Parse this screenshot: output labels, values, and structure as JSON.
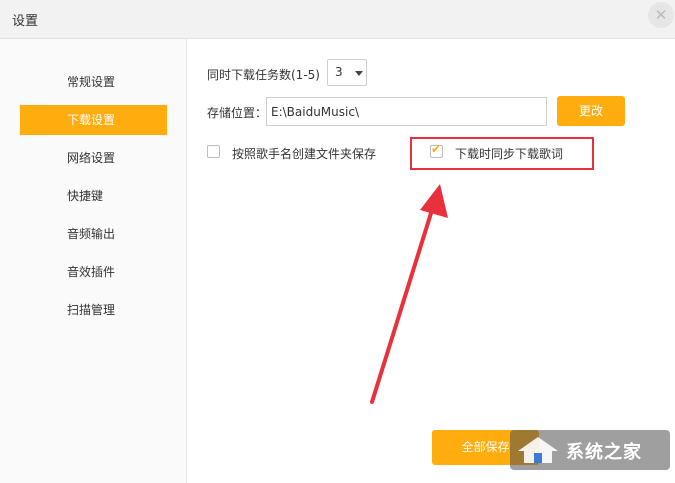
{
  "window": {
    "title": "设置",
    "close_glyph": "✕"
  },
  "sidebar": {
    "items": [
      {
        "label": "常规设置",
        "active": false
      },
      {
        "label": "下载设置",
        "active": true
      },
      {
        "label": "网络设置",
        "active": false
      },
      {
        "label": "快捷键",
        "active": false
      },
      {
        "label": "音频输出",
        "active": false
      },
      {
        "label": "音效插件",
        "active": false
      },
      {
        "label": "扫描管理",
        "active": false
      }
    ]
  },
  "download": {
    "tasks_label": "同时下载任务数(1-5)",
    "tasks_value": "3",
    "path_label": "存储位置：",
    "path_value": "E:\\BaiduMusic\\",
    "change_button": "更改",
    "create_folder_label": "按照歌手名创建文件夹保存",
    "create_folder_checked": false,
    "sync_lyrics_label": "下载时同步下载歌词",
    "sync_lyrics_checked": true
  },
  "footer": {
    "save_all": "全部保存"
  },
  "watermark": {
    "text": "系统之家"
  },
  "colors": {
    "accent": "#ffac0e",
    "annotation": "#e8313c"
  }
}
